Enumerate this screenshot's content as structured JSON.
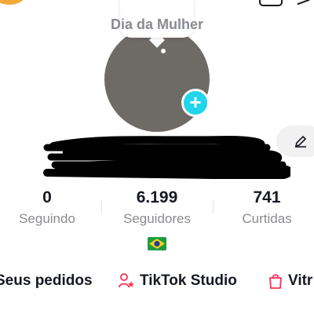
{
  "profile": {
    "note_text": "Dia da Mulher",
    "stats": [
      {
        "value": "0",
        "label": "Seguindo"
      },
      {
        "value": "6.199",
        "label": "Seguidores"
      },
      {
        "value": "741",
        "label": "Curtidas"
      }
    ],
    "country_flag": "Brazil"
  },
  "quick_links": [
    {
      "label": "Seus pedidos",
      "icon": "orders-icon"
    },
    {
      "label": "TikTok Studio",
      "icon": "studio-icon"
    },
    {
      "label": "Vitr",
      "icon": "shopping-bag-icon"
    }
  ],
  "colors": {
    "accent_plus": "#20d5ec",
    "shop_icon": "#fe2c55",
    "text_primary": "#161823",
    "text_secondary": "#8a8b91"
  }
}
